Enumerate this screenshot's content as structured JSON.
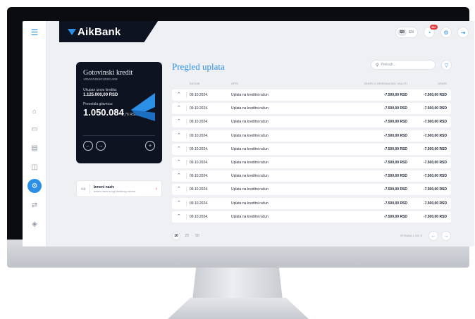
{
  "header": {
    "brand": "AikBank",
    "languages": [
      "SR",
      "EN"
    ],
    "notification_badge": "99+"
  },
  "sidebar": {
    "items": [
      {
        "icon": "menu-icon"
      },
      {
        "icon": "home-icon"
      },
      {
        "icon": "cash-icon"
      },
      {
        "icon": "card-icon"
      },
      {
        "icon": "wallet-icon"
      },
      {
        "icon": "loan-icon",
        "active": true
      },
      {
        "icon": "transfer-icon"
      },
      {
        "icon": "tag-icon"
      }
    ]
  },
  "loan_card": {
    "title": "Gotovinski kredit",
    "number": "105010455010381408",
    "total_label": "Ukupan iznos kredita:",
    "total_value": "1.125.000,00 RSD",
    "principal_label": "Preostala glavnica:",
    "principal_main": "1.050.084",
    "principal_rest": ",76 RSD"
  },
  "rename": {
    "title": "Izmeni naziv",
    "subtitle": "Izmeni naziv svog kreditnog računa"
  },
  "payments": {
    "title": "Pregled uplata",
    "search_placeholder": "Pretraži...",
    "columns": {
      "date": "DATUM",
      "desc": "OPIS",
      "orig": "IZNOS U ORIGINALNOJ VALUTI",
      "amount": "IZNOS"
    },
    "rows": [
      {
        "date": "09.10.2024.",
        "desc": "Uplata na kreditni račun",
        "orig": "-7.500,00 RSD",
        "amount": "-7.500,00 RSD"
      },
      {
        "date": "09.10.2024.",
        "desc": "Uplata na kreditni račun",
        "orig": "-7.500,00 RSD",
        "amount": "-7.500,00 RSD"
      },
      {
        "date": "09.10.2024.",
        "desc": "Uplata na kreditni račun",
        "orig": "-7.500,00 RSD",
        "amount": "-7.500,00 RSD"
      },
      {
        "date": "09.10.2024.",
        "desc": "Uplata na kreditni račun",
        "orig": "-7.500,00 RSD",
        "amount": "-7.500,00 RSD"
      },
      {
        "date": "09.10.2024.",
        "desc": "Uplata na kreditni račun",
        "orig": "-7.500,00 RSD",
        "amount": "-7.500,00 RSD"
      },
      {
        "date": "09.10.2024.",
        "desc": "Uplata na kreditni račun",
        "orig": "-7.500,00 RSD",
        "amount": "-7.500,00 RSD"
      },
      {
        "date": "09.10.2024.",
        "desc": "Uplata na kreditni račun",
        "orig": "-7.500,00 RSD",
        "amount": "-7.500,00 RSD"
      },
      {
        "date": "09.10.2024.",
        "desc": "Uplata na kreditni račun",
        "orig": "-7.500,00 RSD",
        "amount": "-7.500,00 RSD"
      },
      {
        "date": "09.10.2024.",
        "desc": "Uplata na kreditni račun",
        "orig": "-7.500,00 RSD",
        "amount": "-7.500,00 RSD"
      },
      {
        "date": "09.10.2024.",
        "desc": "Uplata na kreditni račun",
        "orig": "-7.500,00 RSD",
        "amount": "-7.500,00 RSD"
      }
    ],
    "page_sizes": [
      "10",
      "20",
      "50"
    ],
    "page_info": "STRANA 1 OD 5"
  }
}
